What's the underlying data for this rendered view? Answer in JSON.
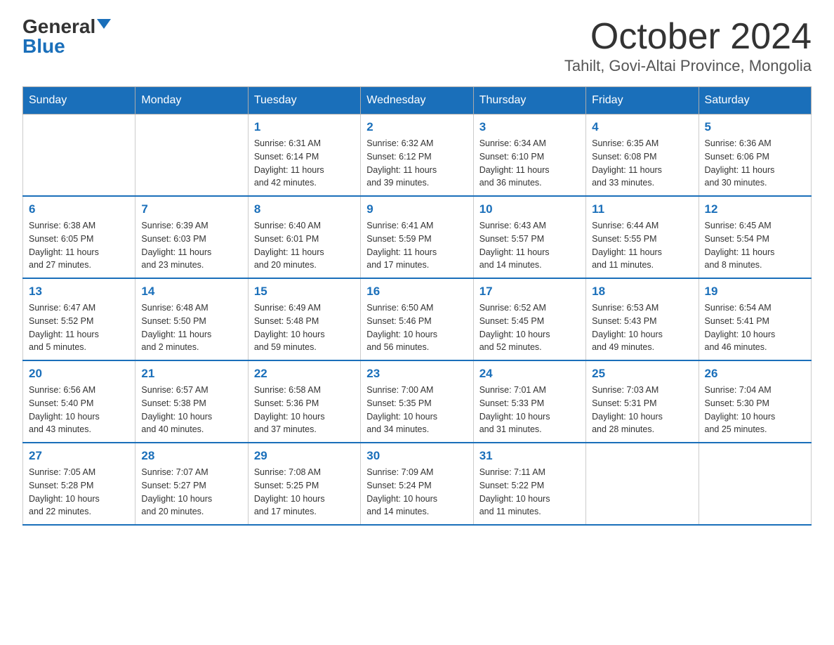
{
  "logo": {
    "general": "General",
    "blue": "Blue"
  },
  "title": "October 2024",
  "subtitle": "Tahilt, Govi-Altai Province, Mongolia",
  "days_of_week": [
    "Sunday",
    "Monday",
    "Tuesday",
    "Wednesday",
    "Thursday",
    "Friday",
    "Saturday"
  ],
  "weeks": [
    [
      {
        "day": "",
        "info": ""
      },
      {
        "day": "",
        "info": ""
      },
      {
        "day": "1",
        "info": "Sunrise: 6:31 AM\nSunset: 6:14 PM\nDaylight: 11 hours\nand 42 minutes."
      },
      {
        "day": "2",
        "info": "Sunrise: 6:32 AM\nSunset: 6:12 PM\nDaylight: 11 hours\nand 39 minutes."
      },
      {
        "day": "3",
        "info": "Sunrise: 6:34 AM\nSunset: 6:10 PM\nDaylight: 11 hours\nand 36 minutes."
      },
      {
        "day": "4",
        "info": "Sunrise: 6:35 AM\nSunset: 6:08 PM\nDaylight: 11 hours\nand 33 minutes."
      },
      {
        "day": "5",
        "info": "Sunrise: 6:36 AM\nSunset: 6:06 PM\nDaylight: 11 hours\nand 30 minutes."
      }
    ],
    [
      {
        "day": "6",
        "info": "Sunrise: 6:38 AM\nSunset: 6:05 PM\nDaylight: 11 hours\nand 27 minutes."
      },
      {
        "day": "7",
        "info": "Sunrise: 6:39 AM\nSunset: 6:03 PM\nDaylight: 11 hours\nand 23 minutes."
      },
      {
        "day": "8",
        "info": "Sunrise: 6:40 AM\nSunset: 6:01 PM\nDaylight: 11 hours\nand 20 minutes."
      },
      {
        "day": "9",
        "info": "Sunrise: 6:41 AM\nSunset: 5:59 PM\nDaylight: 11 hours\nand 17 minutes."
      },
      {
        "day": "10",
        "info": "Sunrise: 6:43 AM\nSunset: 5:57 PM\nDaylight: 11 hours\nand 14 minutes."
      },
      {
        "day": "11",
        "info": "Sunrise: 6:44 AM\nSunset: 5:55 PM\nDaylight: 11 hours\nand 11 minutes."
      },
      {
        "day": "12",
        "info": "Sunrise: 6:45 AM\nSunset: 5:54 PM\nDaylight: 11 hours\nand 8 minutes."
      }
    ],
    [
      {
        "day": "13",
        "info": "Sunrise: 6:47 AM\nSunset: 5:52 PM\nDaylight: 11 hours\nand 5 minutes."
      },
      {
        "day": "14",
        "info": "Sunrise: 6:48 AM\nSunset: 5:50 PM\nDaylight: 11 hours\nand 2 minutes."
      },
      {
        "day": "15",
        "info": "Sunrise: 6:49 AM\nSunset: 5:48 PM\nDaylight: 10 hours\nand 59 minutes."
      },
      {
        "day": "16",
        "info": "Sunrise: 6:50 AM\nSunset: 5:46 PM\nDaylight: 10 hours\nand 56 minutes."
      },
      {
        "day": "17",
        "info": "Sunrise: 6:52 AM\nSunset: 5:45 PM\nDaylight: 10 hours\nand 52 minutes."
      },
      {
        "day": "18",
        "info": "Sunrise: 6:53 AM\nSunset: 5:43 PM\nDaylight: 10 hours\nand 49 minutes."
      },
      {
        "day": "19",
        "info": "Sunrise: 6:54 AM\nSunset: 5:41 PM\nDaylight: 10 hours\nand 46 minutes."
      }
    ],
    [
      {
        "day": "20",
        "info": "Sunrise: 6:56 AM\nSunset: 5:40 PM\nDaylight: 10 hours\nand 43 minutes."
      },
      {
        "day": "21",
        "info": "Sunrise: 6:57 AM\nSunset: 5:38 PM\nDaylight: 10 hours\nand 40 minutes."
      },
      {
        "day": "22",
        "info": "Sunrise: 6:58 AM\nSunset: 5:36 PM\nDaylight: 10 hours\nand 37 minutes."
      },
      {
        "day": "23",
        "info": "Sunrise: 7:00 AM\nSunset: 5:35 PM\nDaylight: 10 hours\nand 34 minutes."
      },
      {
        "day": "24",
        "info": "Sunrise: 7:01 AM\nSunset: 5:33 PM\nDaylight: 10 hours\nand 31 minutes."
      },
      {
        "day": "25",
        "info": "Sunrise: 7:03 AM\nSunset: 5:31 PM\nDaylight: 10 hours\nand 28 minutes."
      },
      {
        "day": "26",
        "info": "Sunrise: 7:04 AM\nSunset: 5:30 PM\nDaylight: 10 hours\nand 25 minutes."
      }
    ],
    [
      {
        "day": "27",
        "info": "Sunrise: 7:05 AM\nSunset: 5:28 PM\nDaylight: 10 hours\nand 22 minutes."
      },
      {
        "day": "28",
        "info": "Sunrise: 7:07 AM\nSunset: 5:27 PM\nDaylight: 10 hours\nand 20 minutes."
      },
      {
        "day": "29",
        "info": "Sunrise: 7:08 AM\nSunset: 5:25 PM\nDaylight: 10 hours\nand 17 minutes."
      },
      {
        "day": "30",
        "info": "Sunrise: 7:09 AM\nSunset: 5:24 PM\nDaylight: 10 hours\nand 14 minutes."
      },
      {
        "day": "31",
        "info": "Sunrise: 7:11 AM\nSunset: 5:22 PM\nDaylight: 10 hours\nand 11 minutes."
      },
      {
        "day": "",
        "info": ""
      },
      {
        "day": "",
        "info": ""
      }
    ]
  ]
}
